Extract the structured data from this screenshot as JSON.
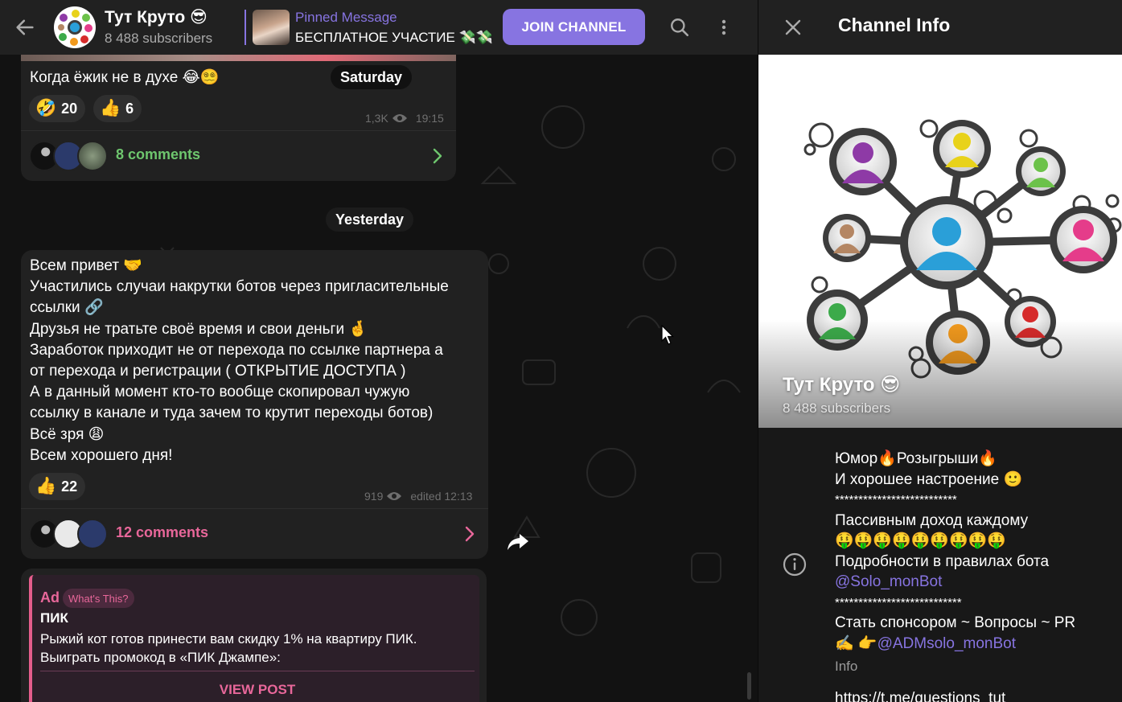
{
  "header": {
    "channel_title": "Тут Круто 😎",
    "subscribers": "8 488 subscribers",
    "pinned_label": "Pinned Message",
    "pinned_text": "БЕСПЛАТНОЕ УЧАСТИЕ 💸💸",
    "join_label": "JOIN CHANNEL"
  },
  "messages": [
    {
      "text": "Когда ёжик не в духе 😂😵‍💫",
      "date_badge": "Saturday",
      "reactions": [
        {
          "emoji": "🤣",
          "count": "20"
        },
        {
          "emoji": "👍",
          "count": "6"
        }
      ],
      "views": "1,3K",
      "time": "19:15",
      "comments": "8 comments"
    },
    {
      "lines": [
        "Всем привет 🤝",
        "Участились случаи накрутки ботов через пригласительные",
        "ссылки 🔗",
        "Друзья не тратьте своё время и свои деньги 🤞",
        "Заработок приходит не от перехода по ссылке партнера а",
        "от перехода и регистрации ( ОТКРЫТИЕ ДОСТУПА )",
        "А в данный момент кто-то вообще скопировал чужую",
        "ссылку в канале и туда зачем то крутит переходы ботов)",
        "Всё зря 😩",
        "Всем хорошего дня!"
      ],
      "reactions": [
        {
          "emoji": "👍",
          "count": "22"
        }
      ],
      "views": "919",
      "time": "edited 12:13",
      "comments": "12 comments"
    }
  ],
  "date_separator": "Yesterday",
  "ad": {
    "label": "Ad",
    "whats_this": "What's This?",
    "title": "ПИК",
    "lines": [
      "Рыжий кот готов принести вам скидку 1% на квартиру ПИК.",
      "Выиграть промокод в «ПИК Джампе»:"
    ],
    "button": "VIEW POST"
  },
  "info_panel": {
    "title": "Channel Info",
    "channel_name": "Тут Круто 😎",
    "subscribers": "8 488 subscribers",
    "description_lines": [
      "Юмор🔥Розыгрыши🔥",
      "И хорошее настроение 🙂",
      "**************************",
      "Пассивным доход каждому",
      "🤑🤑🤑🤑🤑🤑🤑🤑🤑",
      "Подробности в правилах бота"
    ],
    "bot_link": "@Solo_monBot",
    "stars2": "***************************",
    "sponsor_line": "Стать спонсором ~ Вопросы ~ PR",
    "admin_prefix": "✍️ 👉",
    "admin_link": "@ADMsolo_monBot",
    "caption": "Info",
    "url_partial": "https://t.me/questions_tut"
  },
  "colors": {
    "accent": "#8774e1",
    "comments_green": "#6ec66e",
    "comments_pink": "#e8679a",
    "bubble": "#212121",
    "header": "#212121"
  }
}
